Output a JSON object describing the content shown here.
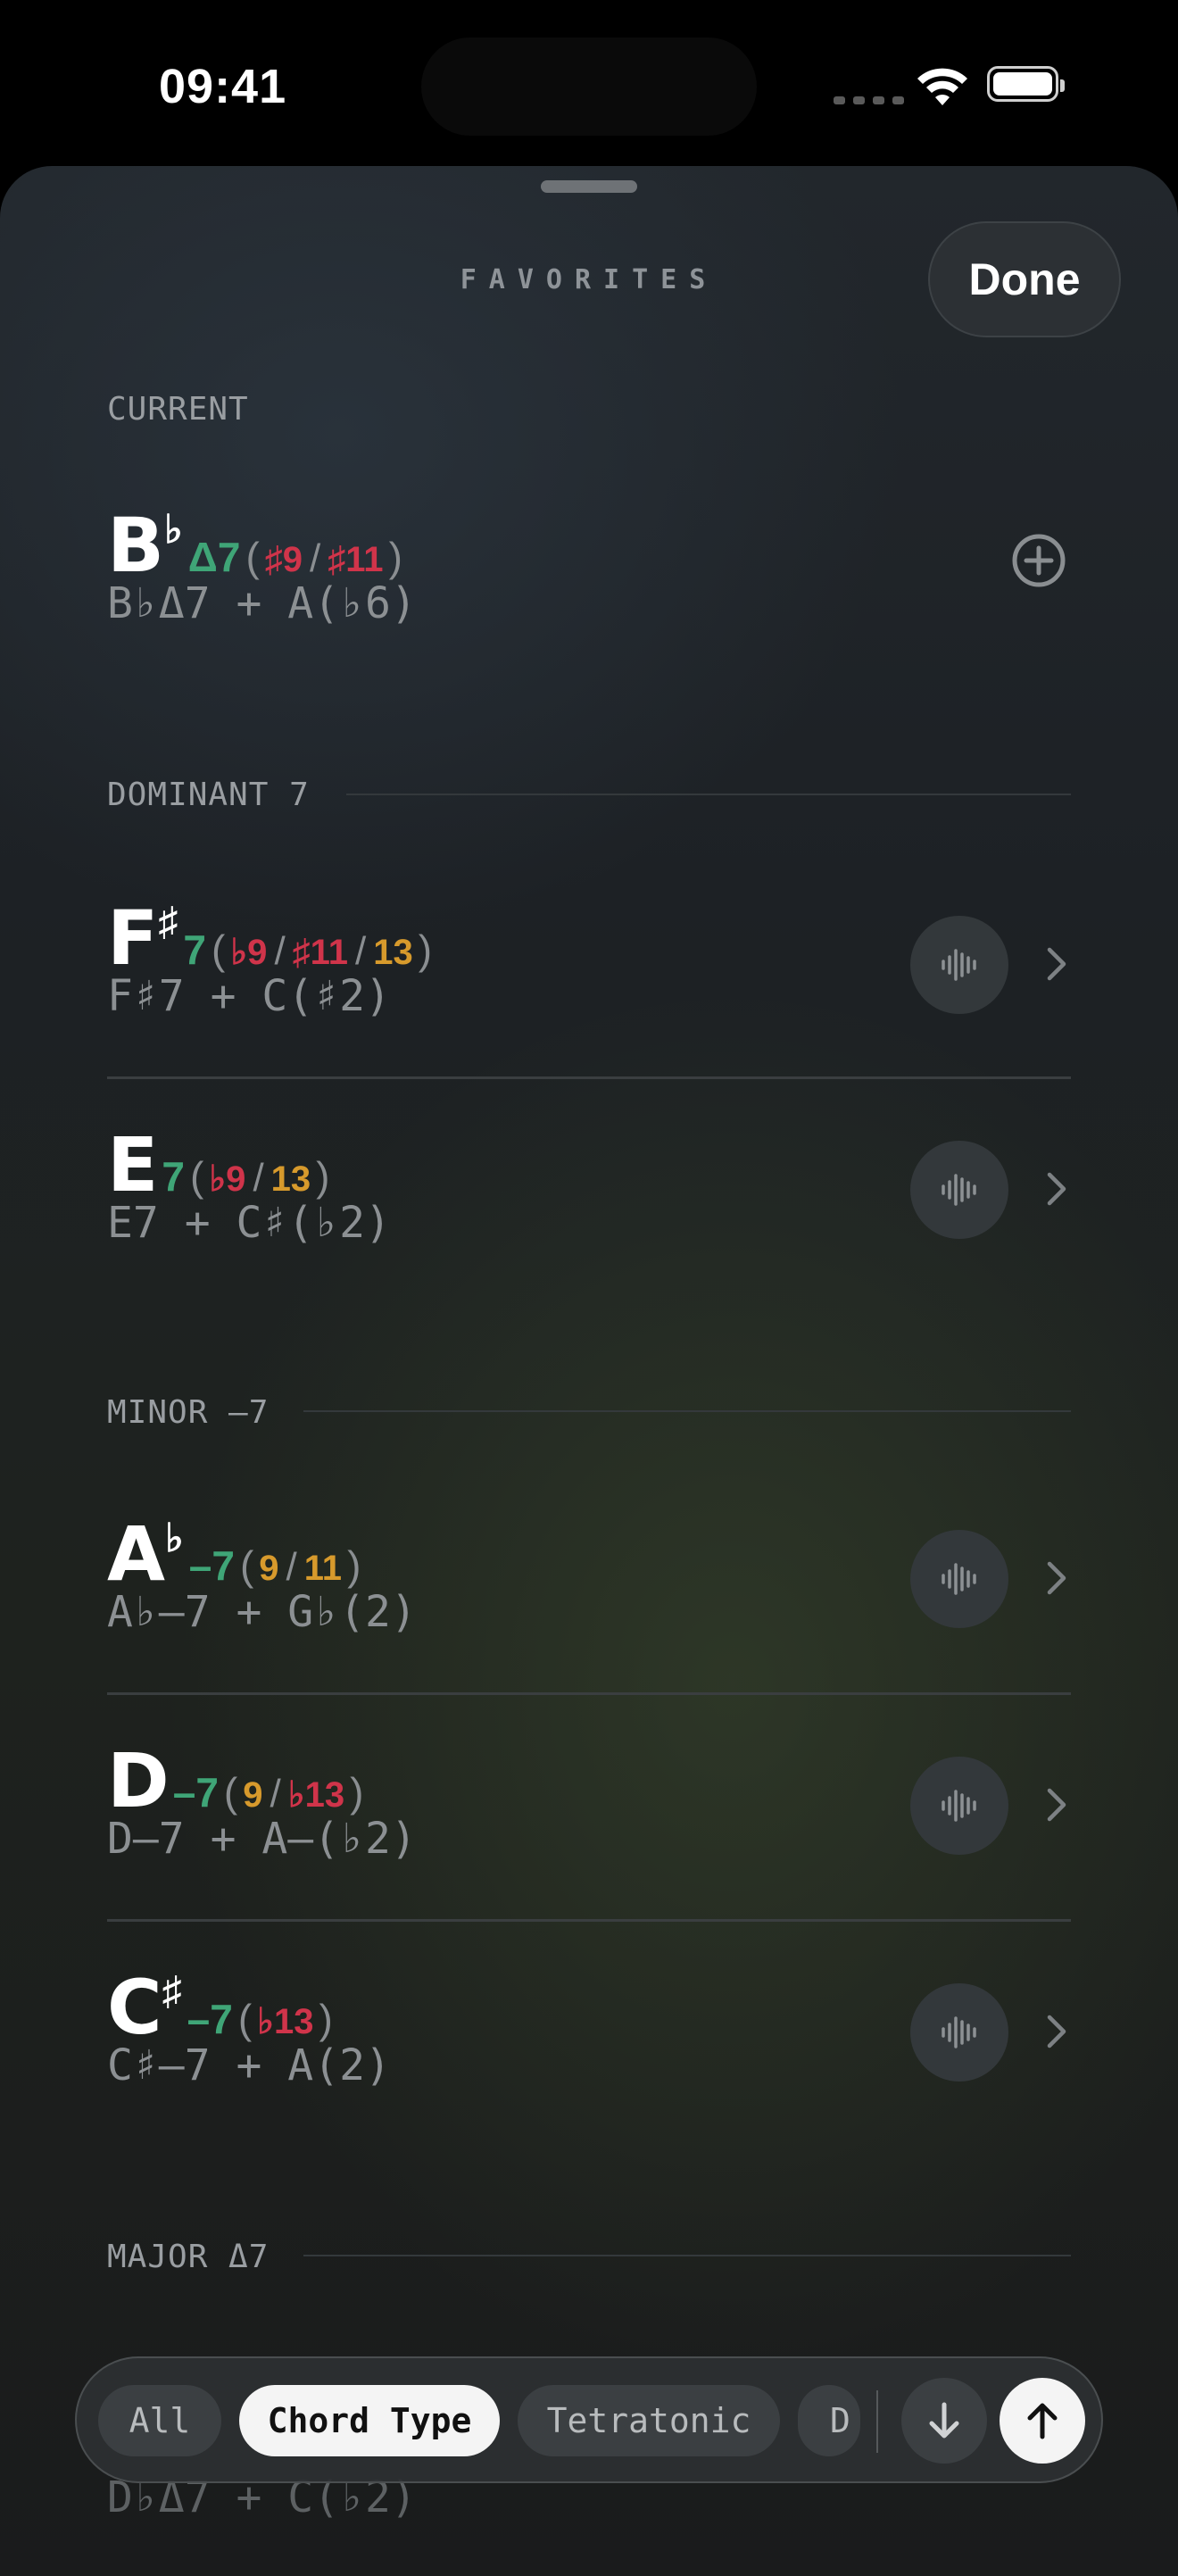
{
  "status_bar": {
    "time": "09:41"
  },
  "sheet": {
    "title": "FAVORITES",
    "done_label": "Done"
  },
  "current": {
    "label": "CURRENT",
    "chord": {
      "root": "B",
      "accidental": "♭",
      "quality": "Δ7",
      "open": "(",
      "close": ")",
      "ext1": "♯9",
      "sep1": "/",
      "ext2": "♯11"
    },
    "subtitle": "B♭Δ7 + A(♭6)"
  },
  "sections": {
    "dominant": {
      "label": "DOMINANT 7"
    },
    "minor": {
      "label": "MINOR –7"
    },
    "major": {
      "label": "MAJOR Δ7"
    }
  },
  "rows": {
    "fsharp": {
      "root": "F",
      "accidental": "♯",
      "quality": "7",
      "open": "(",
      "close": ")",
      "ext1": "♭9",
      "sep1": "/",
      "ext2": "♯11",
      "sep2": "/",
      "ext3": "13",
      "subtitle": "F♯7 + C(♯2)"
    },
    "e": {
      "root": "E",
      "quality": "7",
      "open": "(",
      "close": ")",
      "ext1": "♭9",
      "sep1": "/",
      "ext2": "13",
      "subtitle": "E7 + C♯(♭2)"
    },
    "aflat": {
      "root": "A",
      "accidental": "♭",
      "quality": "–7",
      "open": "(",
      "close": ")",
      "ext1": "9",
      "sep1": "/",
      "ext2": "11",
      "subtitle": "A♭–7 + G♭(2)"
    },
    "d": {
      "root": "D",
      "quality": "–7",
      "open": "(",
      "close": ")",
      "ext1": "9",
      "sep1": "/",
      "ext2": "♭13",
      "subtitle": "D–7 + A–(♭2)"
    },
    "csharp": {
      "root": "C",
      "accidental": "♯",
      "quality": "–7",
      "open": "(",
      "close": ")",
      "ext1": "♭13",
      "subtitle": "C♯–7 + A(2)"
    }
  },
  "filter_bar": {
    "chips": [
      "All",
      "Chord Type",
      "Tetratonic",
      "D"
    ],
    "active": "Chord Type",
    "under_text": "D♭Δ7 + C(♭2)"
  },
  "colors": {
    "quality_green": "#3fa577",
    "extension_red": "#d0344a",
    "extension_amber": "#d79a2c"
  },
  "icons": [
    "wifi-icon",
    "battery-icon",
    "add-circle-icon",
    "waveform-icon",
    "chevron-right-icon",
    "arrow-down-icon",
    "arrow-up-icon"
  ]
}
